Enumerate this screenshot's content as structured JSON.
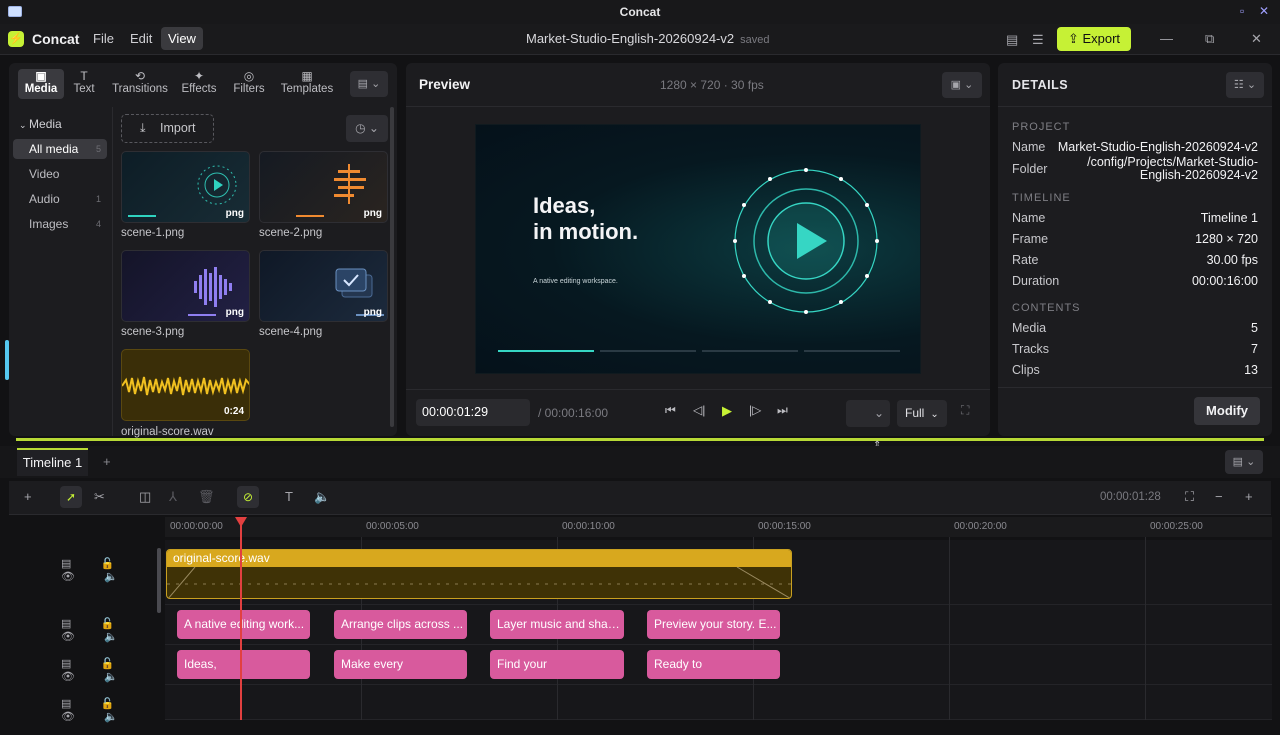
{
  "titlebar": {
    "app_title": "Concat"
  },
  "menubar": {
    "brand": "Concat",
    "menus": [
      "File",
      "Edit",
      "View"
    ],
    "project_title": "Market-Studio-English-20260924-v2",
    "saved_status": "saved",
    "export_label": "Export"
  },
  "media": {
    "tabs": [
      {
        "label": "Media",
        "icon": "film-icon"
      },
      {
        "label": "Text",
        "icon": "text-icon"
      },
      {
        "label": "Transitions",
        "icon": "transition-icon"
      },
      {
        "label": "Effects",
        "icon": "sparkle-icon"
      },
      {
        "label": "Filters",
        "icon": "filter-icon"
      },
      {
        "label": "Templates",
        "icon": "template-icon"
      }
    ],
    "sidebar_header": "Media",
    "sidebar": [
      {
        "label": "All media",
        "count": "5"
      },
      {
        "label": "Video",
        "count": ""
      },
      {
        "label": "Audio",
        "count": "1"
      },
      {
        "label": "Images",
        "count": "4"
      }
    ],
    "import_label": "Import",
    "items": [
      {
        "name": "scene-1.png",
        "badge": "png"
      },
      {
        "name": "scene-2.png",
        "badge": "png"
      },
      {
        "name": "scene-3.png",
        "badge": "png"
      },
      {
        "name": "scene-4.png",
        "badge": "png"
      },
      {
        "name": "original-score.wav",
        "badge": "0:24"
      }
    ]
  },
  "preview": {
    "title": "Preview",
    "resolution": "1280 × 720 · 30 fps",
    "headline_1": "Ideas,",
    "headline_2": "in motion.",
    "subtitle": "A native editing workspace.",
    "current_time": "00:00:01:29",
    "total_time": "/ 00:00:16:00",
    "zoom": "Full"
  },
  "details": {
    "title": "DETAILS",
    "project_section": "PROJECT",
    "project_name_label": "Name",
    "project_name": "Market-Studio-English-20260924-v2",
    "folder_label": "Folder",
    "folder_line1": "/config/Projects/Market-Studio-",
    "folder_line2": "English-20260924-v2",
    "timeline_section": "TIMELINE",
    "timeline_name_label": "Name",
    "timeline_name": "Timeline 1",
    "frame_label": "Frame",
    "frame": "1280 × 720",
    "rate_label": "Rate",
    "rate": "30.00 fps",
    "duration_label": "Duration",
    "duration": "00:00:16:00",
    "contents_section": "CONTENTS",
    "media_label": "Media",
    "media_count": "5",
    "tracks_label": "Tracks",
    "tracks_count": "7",
    "clips_label": "Clips",
    "clips_count": "13",
    "modify_label": "Modify"
  },
  "timeline": {
    "tab": "Timeline 1",
    "add_tab": "+",
    "timecode": "00:00:01:28",
    "ruler": [
      "00:00:00:00",
      "00:00:05:00",
      "00:00:10:00",
      "00:00:15:00",
      "00:00:20:00",
      "00:00:25:00"
    ],
    "audio_clip": "original-score.wav",
    "subtitle_clips": [
      "A native editing work...",
      "Arrange clips across ...",
      "Layer music and shap...",
      "Preview your story. E..."
    ],
    "title_clips": [
      "Ideas,",
      "Make every",
      "Find your",
      "Ready to"
    ]
  },
  "colors": {
    "accent": "#c6f135",
    "clip_pink": "#d85a9d",
    "audio_gold": "#d8a81e",
    "playhead": "#e24040"
  }
}
